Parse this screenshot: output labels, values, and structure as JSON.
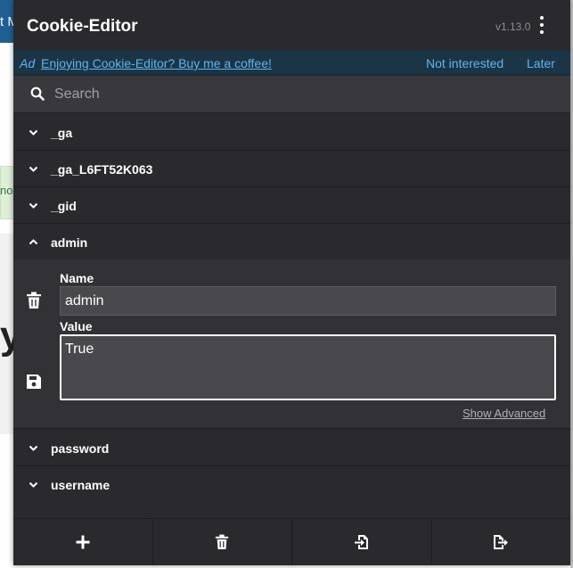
{
  "background_page": {
    "topbar_text": "t M",
    "alert_text": "nou",
    "big_text": "yo"
  },
  "header": {
    "title": "Cookie-Editor",
    "version": "v1.13.0",
    "menu_icon": "kebab-menu-icon"
  },
  "ad": {
    "tag": "Ad",
    "link_text": "Enjoying Cookie-Editor? Buy me a coffee!",
    "dismiss_label": "Not interested",
    "later_label": "Later"
  },
  "search": {
    "placeholder": "Search",
    "value": ""
  },
  "cookies": [
    {
      "name": "_ga",
      "expanded": false
    },
    {
      "name": "_ga_L6FT52K063",
      "expanded": false
    },
    {
      "name": "_gid",
      "expanded": false
    },
    {
      "name": "admin",
      "expanded": true
    },
    {
      "name": "password",
      "expanded": false
    },
    {
      "name": "username",
      "expanded": false
    }
  ],
  "editor": {
    "name_label": "Name",
    "name_value": "admin",
    "value_label": "Value",
    "value_value": "True",
    "show_advanced_label": "Show Advanced"
  },
  "footer": {
    "buttons": [
      {
        "icon": "plus-icon",
        "action": "add"
      },
      {
        "icon": "trash-icon",
        "action": "delete-all"
      },
      {
        "icon": "import-icon",
        "action": "import"
      },
      {
        "icon": "export-icon",
        "action": "export"
      }
    ]
  },
  "colors": {
    "popup_bg": "#2a2a2e",
    "ad_bg": "#1c3546",
    "link": "#5fb3ef",
    "page_header": "#1f5f94"
  }
}
